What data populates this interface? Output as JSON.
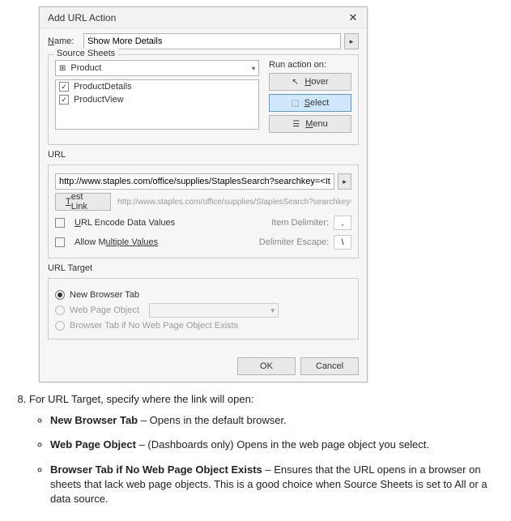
{
  "dialog": {
    "title": "Add URL Action",
    "name_label_pre": "N",
    "name_label_post": "ame:",
    "name_value": "Show More Details",
    "source_sheets_label": "Source Sheets",
    "sheet_dropdown": "Product",
    "sheets": [
      "ProductDetails",
      "ProductView"
    ],
    "run_action_on": "Run action on:",
    "hover_pre": "H",
    "hover_post": "over",
    "select_pre": "S",
    "select_post": "elect",
    "menu_pre": "M",
    "menu_post": "enu",
    "url_section": "URL",
    "url_value": "http://www.staples.com/office/supplies/StaplesSearch?searchkey=<Item>",
    "test_link_pre": "T",
    "test_link_post": "est Link",
    "url_preview": "http://www.staples.com/office/supplies/StaplesSearch?searchkey=<",
    "encode_pre": "U",
    "encode_post": "RL Encode Data Values",
    "item_delim_label": "Item Delimiter:",
    "item_delim_val": ",",
    "allow_mult_pre": "Allow M",
    "allow_mult_post": "ultiple Values",
    "delim_escape_label": "Delimiter Escape:",
    "delim_escape_val": "\\",
    "target_section": "URL Target",
    "opt_new_tab": "New Browser Tab",
    "opt_wpo": "Web Page Object",
    "opt_fallback": "Browser Tab if No Web Page Object Exists",
    "ok": "OK",
    "cancel": "Cancel"
  },
  "doc": {
    "step_num": "8.",
    "step_text": "For URL Target, specify where the link will open:",
    "b1_t": "New Browser Tab",
    "b1_r": " – Opens in the default browser.",
    "b2_t": "Web Page Object",
    "b2_r": " – (Dashboards only) Opens in the web page object you select.",
    "b3_t": "Browser Tab if No Web Page Object Exists",
    "b3_r": " – Ensures that the URL opens in a browser on sheets that lack web page objects. This is a good choice when Source Sheets is set to All or a data source."
  }
}
